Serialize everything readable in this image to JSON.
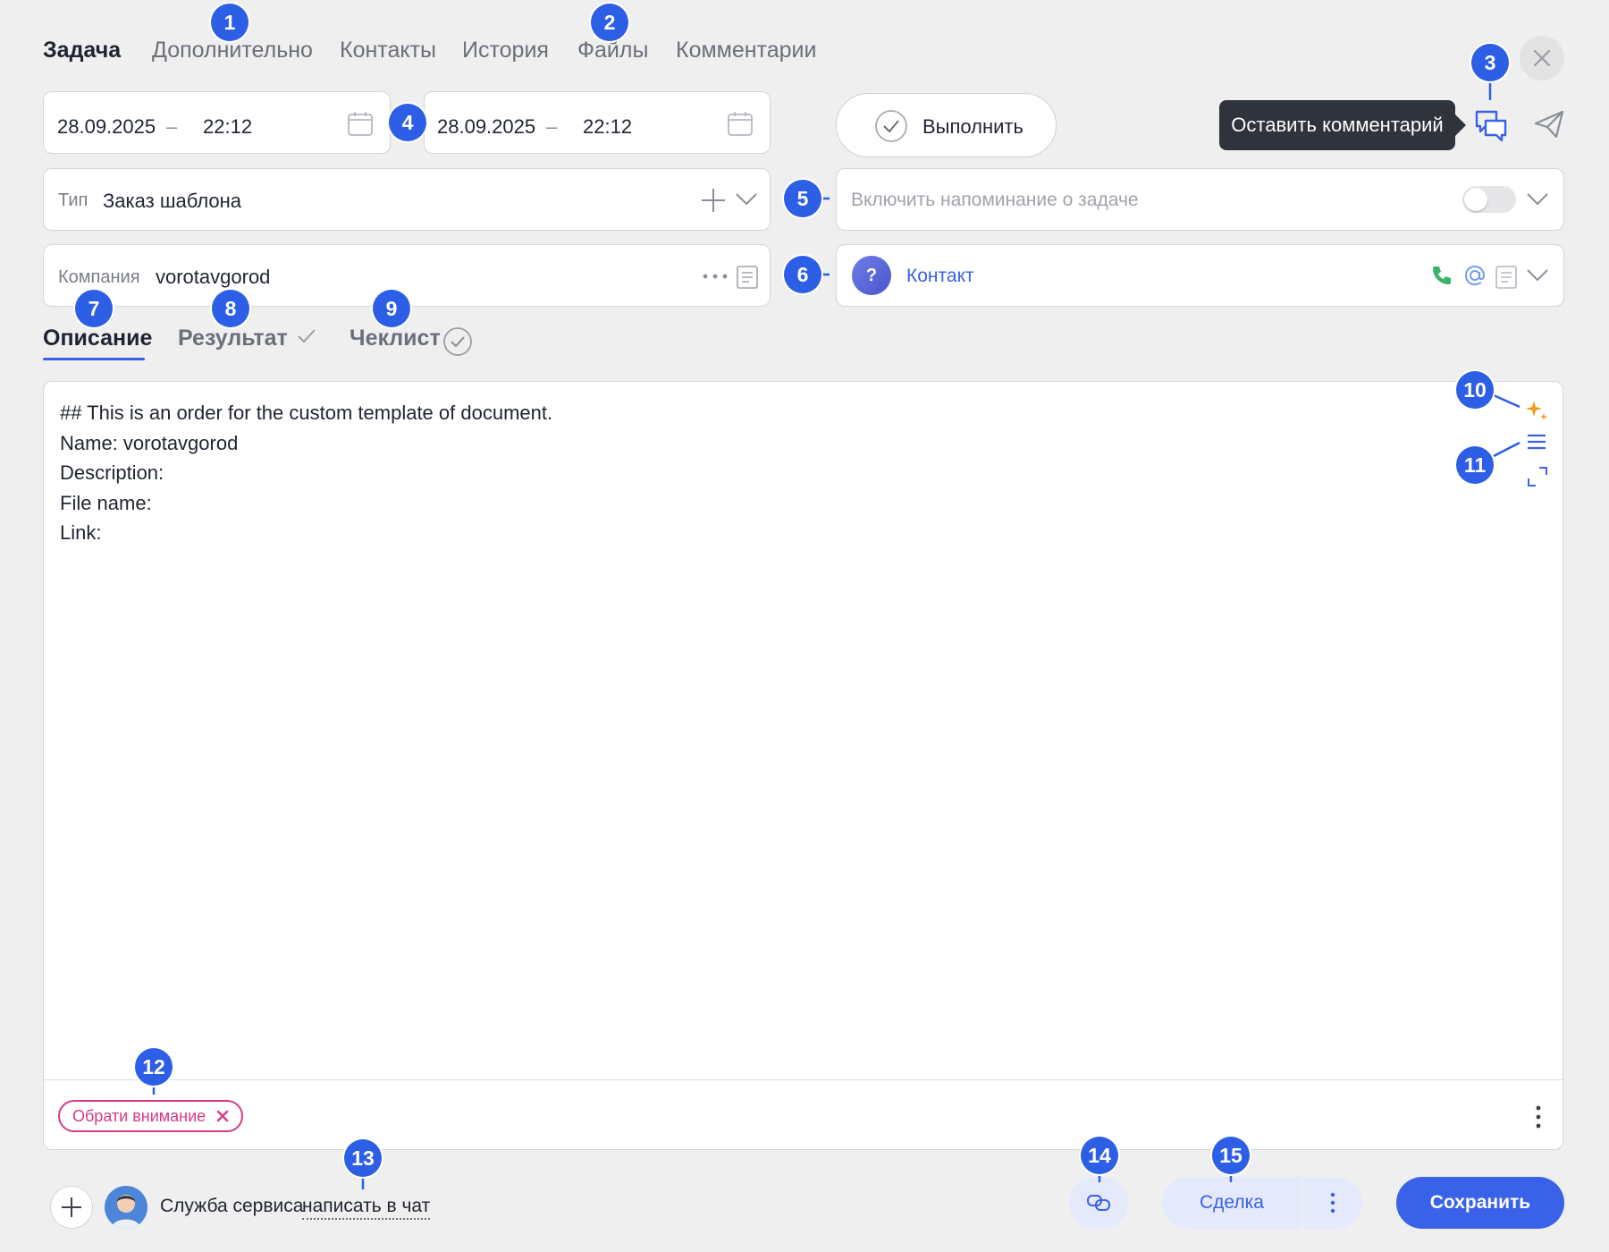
{
  "tabs": {
    "task": "Задача",
    "additional": "Дополнительно",
    "contacts": "Контакты",
    "history": "История",
    "files": "Файлы",
    "comments": "Комментарии"
  },
  "dates": {
    "start_date": "28.09.2025",
    "start_time": "22:12",
    "end_date": "28.09.2025",
    "end_time": "22:12",
    "dash": "–"
  },
  "actions": {
    "perform_label": "Выполнить",
    "tooltip": "Оставить комментарий"
  },
  "type_field": {
    "label": "Тип",
    "value": "Заказ шаблона"
  },
  "reminder": {
    "placeholder": "Включить напоминание о задаче",
    "enabled": false
  },
  "company_field": {
    "label": "Компания",
    "value": "vorotavgorod"
  },
  "contact_field": {
    "avatar_glyph": "?",
    "label": "Контакт"
  },
  "subtabs": {
    "description": "Описание",
    "result": "Результат",
    "checklist": "Чеклист"
  },
  "editor": {
    "lines": [
      "## This is an order for the custom template of document.",
      "Name: vorotavgorod",
      "Description:",
      "File name:",
      "Link:"
    ],
    "tag_label": "Обрати внимание"
  },
  "bottom": {
    "service_label": "Служба сервиса",
    "chat_link": "написать в чат",
    "deal_label": "Сделка",
    "save_label": "Сохранить"
  },
  "markers": [
    "1",
    "2",
    "3",
    "4",
    "5",
    "6",
    "7",
    "8",
    "9",
    "10",
    "11",
    "12",
    "13",
    "14",
    "15"
  ],
  "colors": {
    "accent": "#3a62e8",
    "marker": "#2d5ee6",
    "tag": "#d63a87",
    "phone": "#3ab36b",
    "sparkle": "#f29a1b"
  },
  "icons": [
    "close-icon",
    "calendar-icon",
    "check-circle-icon",
    "comment-icon",
    "send-icon",
    "plus-icon",
    "chevron-down-icon",
    "more-horizontal-icon",
    "document-icon",
    "phone-icon",
    "at-icon",
    "check-icon",
    "sparkle-icon",
    "align-icon",
    "expand-icon",
    "more-vertical-icon",
    "link-icon"
  ]
}
